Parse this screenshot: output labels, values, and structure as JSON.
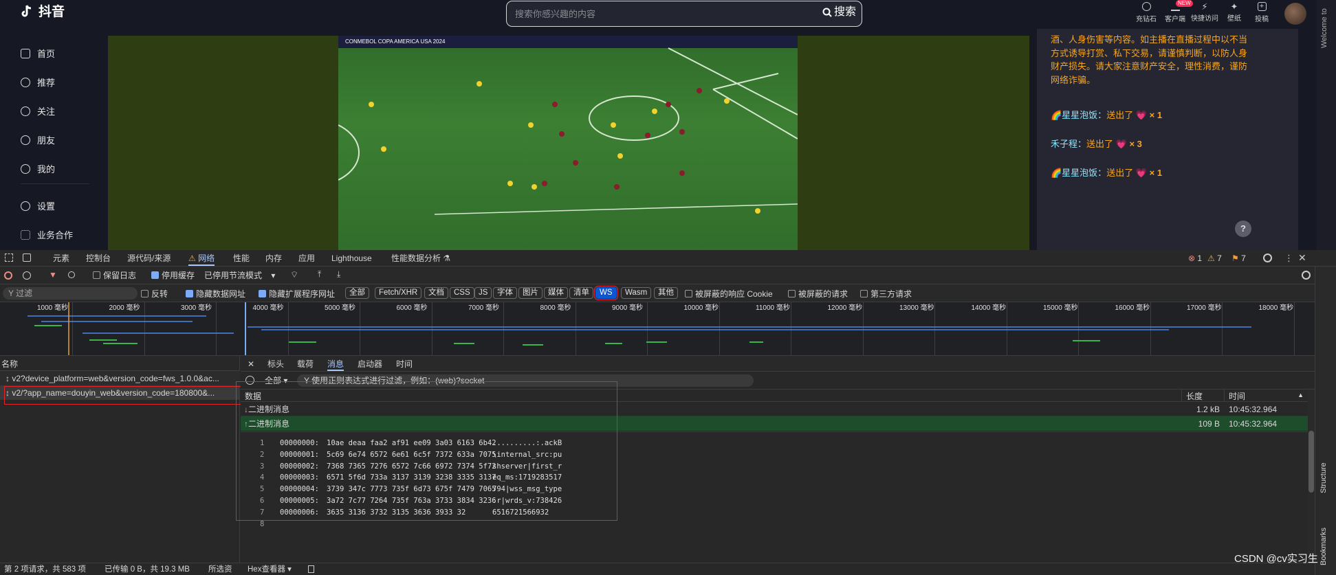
{
  "topbar": {
    "logo": "抖音",
    "search_placeholder": "搜索你感兴趣的内容",
    "search_button": "搜索",
    "actions": [
      {
        "label": "充钻石"
      },
      {
        "label": "客户端",
        "badge": "NEW"
      },
      {
        "label": "快捷访问"
      },
      {
        "label": "壁纸"
      },
      {
        "label": "投稿"
      }
    ],
    "welcome_text": "Welcome to"
  },
  "sidebar": {
    "items": [
      {
        "label": "首页"
      },
      {
        "label": "推荐"
      },
      {
        "label": "关注"
      },
      {
        "label": "朋友"
      },
      {
        "label": "我的"
      },
      {
        "label": "设置"
      },
      {
        "label": "业务合作"
      }
    ]
  },
  "video": {
    "banner": "CONMEBOL COPA AMERICA USA 2024"
  },
  "chat": {
    "notice": [
      "酒、人身伤害等内容。如主播在直播过程中以不当",
      "方式诱导打赏、私下交易，请谨慎判断，以防人身",
      "财产损失。请大家注意财产安全，理性消费，谨防",
      "网络诈骗。"
    ],
    "messages": [
      {
        "user": "🌈星星泡饭：",
        "text": "送出了",
        "count": "× 1"
      },
      {
        "user": "禾子程：",
        "text": "送出了",
        "count": "× 3"
      },
      {
        "user": "🌈星星泡饭：",
        "text": "送出了",
        "count": "× 1"
      }
    ],
    "help": "?"
  },
  "devtools": {
    "tabs": [
      "元素",
      "控制台",
      "源代码/来源",
      "网络",
      "性能",
      "内存",
      "应用",
      "Lighthouse",
      "性能数据分析"
    ],
    "active_tab": "网络",
    "counts": {
      "errors": "1",
      "warnings": "7",
      "issues": "7"
    },
    "toolbar": {
      "preserve_log": "保留日志",
      "disable_cache": "停用缓存",
      "throttle": "已停用节流模式"
    },
    "filter": {
      "placeholder": "过滤",
      "invert": "反转",
      "hide_data_urls": "隐藏数据网址",
      "hide_ext_urls": "隐藏扩展程序网址",
      "types": [
        "全部",
        "Fetch/XHR",
        "文档",
        "CSS",
        "JS",
        "字体",
        "图片",
        "媒体",
        "清单",
        "WS",
        "Wasm",
        "其他"
      ],
      "blocked_cookies": "被屏蔽的响应 Cookie",
      "blocked_requests": "被屏蔽的请求",
      "third_party": "第三方请求"
    },
    "timeline": [
      "1000 毫秒",
      "2000 毫秒",
      "3000 毫秒",
      "4000 毫秒",
      "5000 毫秒",
      "6000 毫秒",
      "7000 毫秒",
      "8000 毫秒",
      "9000 毫秒",
      "10000 毫秒",
      "11000 毫秒",
      "12000 毫秒",
      "13000 毫秒",
      "14000 毫秒",
      "15000 毫秒",
      "16000 毫秒",
      "17000 毫秒",
      "18000 毫秒"
    ],
    "requests": {
      "header": "名称",
      "rows": [
        "v2?device_platform=web&version_code=fws_1.0.0&ac...",
        "v2/?app_name=douyin_web&version_code=180800&..."
      ]
    },
    "detail_tabs": [
      "标头",
      "载荷",
      "消息",
      "启动器",
      "时间"
    ],
    "active_detail_tab": "消息",
    "msg_filter": {
      "type": "全部",
      "placeholder": "使用正则表达式进行过滤，例如：(web)?socket"
    },
    "msg_table": {
      "cols": [
        "数据",
        "长度",
        "时间"
      ],
      "rows": [
        {
          "data": "二进制消息",
          "length": "1.2 kB",
          "time": "10:45:32.964"
        },
        {
          "data": "二进制消息",
          "length": "109 B",
          "time": "10:45:32.964"
        }
      ]
    },
    "hex": [
      {
        "n": "1",
        "addr": "00000000:",
        "bytes": "10ae deaa faa2 af91 ee09 3a03 6163 6b42",
        "ascii": "..........:.ackB"
      },
      {
        "n": "2",
        "addr": "00000001:",
        "bytes": "5c69 6e74 6572 6e61 6c5f 7372 633a 7075",
        "ascii": "\\internal_src:pu"
      },
      {
        "n": "3",
        "addr": "00000002:",
        "bytes": "7368 7365 7276 6572 7c66 6972 7374 5f72",
        "ascii": "shserver|first_r"
      },
      {
        "n": "4",
        "addr": "00000003:",
        "bytes": "6571 5f6d 733a 3137 3139 3238 3335 3137",
        "ascii": "eq_ms:1719283517"
      },
      {
        "n": "5",
        "addr": "00000004:",
        "bytes": "3739 347c 7773 735f 6d73 675f 7479 7065",
        "ascii": "794|wss_msg_type"
      },
      {
        "n": "6",
        "addr": "00000005:",
        "bytes": "3a72 7c77 7264 735f 763a 3733 3834 3236",
        "ascii": ":r|wrds_v:738426"
      },
      {
        "n": "7",
        "addr": "00000006:",
        "bytes": "3635 3136 3732 3135 3636 3933 32",
        "ascii": "6516721566932"
      },
      {
        "n": "8",
        "addr": "",
        "bytes": "",
        "ascii": ""
      }
    ],
    "status": {
      "requests": "第 2 项请求，共 583 项",
      "transferred": "已传输 0 B，共 19.3 MB",
      "resources": "所选资",
      "viewer": "Hex查看器"
    },
    "side_panel": [
      "Structure",
      "Bookmarks"
    ],
    "watermark": "CSDN @cv实习生"
  }
}
